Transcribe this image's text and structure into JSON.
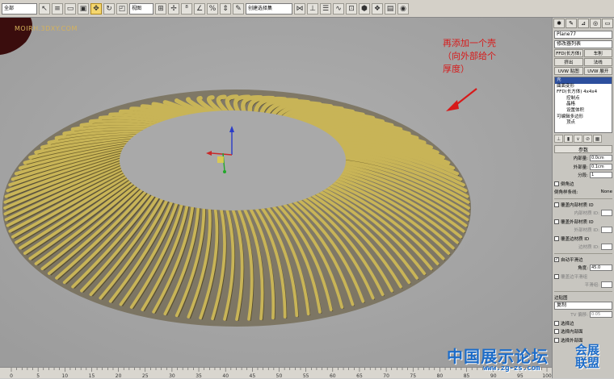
{
  "toolbar": {
    "selection_filter": "全部",
    "ref_coord": "视图",
    "named_selection": "创建选择集"
  },
  "viewport": {
    "watermark_top": "MOIRH.3DXY.COM",
    "annotation_lines": [
      "再添加一个壳",
      "（向外部给个",
      "厚度）"
    ],
    "annotation_color": "#d71a1a",
    "object_color": "#c8b457"
  },
  "ruler": {
    "labels": [
      "0",
      "5",
      "10",
      "15",
      "20",
      "25",
      "30",
      "35",
      "40",
      "45",
      "50",
      "55",
      "60",
      "65",
      "70",
      "75",
      "80",
      "85",
      "90",
      "95",
      "100"
    ]
  },
  "panel": {
    "object_name": "Plane77",
    "modifier_list": "修改器列表",
    "buttons": [
      {
        "label": "FFD(长方体)"
      },
      {
        "label": "车削"
      },
      {
        "label": "挤出"
      },
      {
        "label": "法线"
      },
      {
        "label": "UVW 贴图"
      },
      {
        "label": "UVW 展开"
      }
    ],
    "stack": [
      {
        "label": "壳",
        "selected": true,
        "indent": 0
      },
      {
        "label": "曲面变形",
        "selected": false,
        "indent": 0
      },
      {
        "label": "FFD(长方体) 4x4x4",
        "selected": false,
        "indent": 0
      },
      {
        "label": "控制点",
        "selected": false,
        "indent": 2
      },
      {
        "label": "晶格",
        "selected": false,
        "indent": 2
      },
      {
        "label": "设置体积",
        "selected": false,
        "indent": 2
      },
      {
        "label": "可编辑多边形",
        "selected": false,
        "indent": 0
      },
      {
        "label": "顶点",
        "selected": false,
        "indent": 2
      }
    ],
    "params_title": "参数",
    "inner_amount_label": "内部量:",
    "inner_amount": "0.0cm",
    "outer_amount_label": "外部量:",
    "outer_amount": "0.1cm",
    "segments_label": "分段:",
    "segments": "1",
    "bevel_edges": "倒角边",
    "bevel_spline_label": "倒角样条线:",
    "bevel_spline": "None",
    "override_inner_mat": "覆盖内部材质 ID",
    "inner_mat_id_label": "内部材质 ID:",
    "override_outer_mat": "覆盖外部材质 ID",
    "outer_mat_id_label": "外部材质 ID:",
    "override_edge_mat": "覆盖边材质 ID",
    "edge_mat_id_label": "边材质 ID:",
    "auto_smooth": "自动平滑边",
    "angle_label": "角度:",
    "angle": "45.0",
    "override_smooth": "覆盖边平滑组",
    "smooth_group_label": "平滑组:",
    "edge_mapping_title": "边贴图",
    "edge_mapping": "复制",
    "tv_offset_label": "TV 偏移:",
    "tv_offset": "0.05",
    "select_edges": "选择边",
    "select_inner": "选择内部面",
    "select_outer": "选择外部面"
  },
  "bottom_watermark": {
    "title": "中国展示论坛",
    "url": "www.zg-zs.com",
    "side": "会展 联盟"
  }
}
